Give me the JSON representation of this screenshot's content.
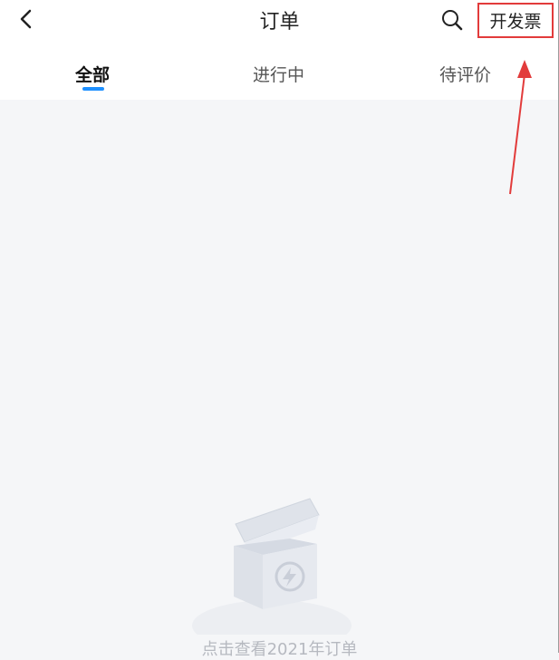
{
  "header": {
    "title": "订单",
    "invoice_label": "开发票",
    "icons": {
      "back": "chevron-left-icon",
      "search": "search-icon"
    }
  },
  "tabs": [
    {
      "label": "全部",
      "active": true
    },
    {
      "label": "进行中",
      "active": false
    },
    {
      "label": "待评价",
      "active": false
    }
  ],
  "empty_state": {
    "text": "点击查看2021年订单"
  },
  "colors": {
    "accent": "#1e90ff",
    "annotation": "#e23b3b",
    "background": "#f5f6f8"
  }
}
